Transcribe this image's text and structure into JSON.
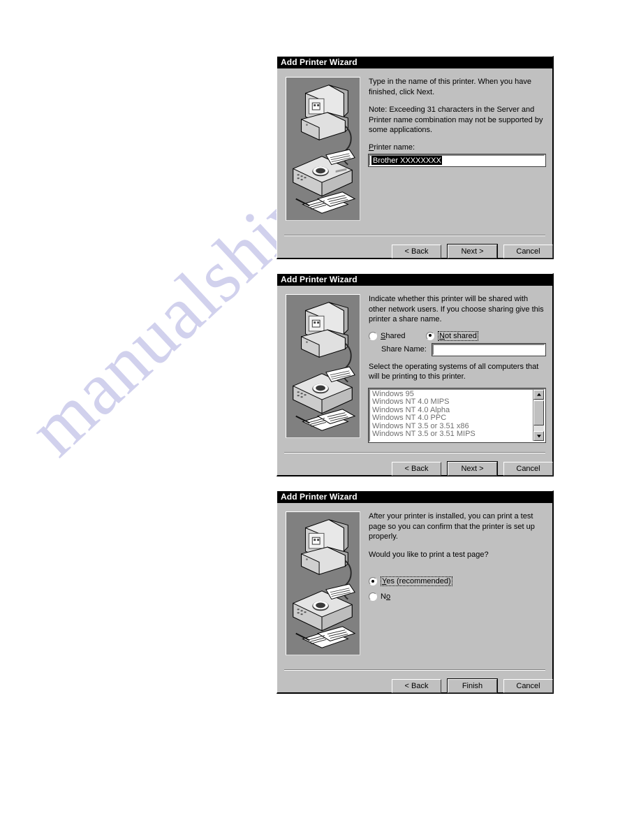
{
  "page": {
    "watermark_text": "manualshive.com",
    "watermark_color": "#c9c9ea",
    "background_color": "#ffffff"
  },
  "common": {
    "title": "Add Printer Wizard",
    "back_label": "< Back",
    "next_label": "Next >",
    "cancel_label": "Cancel",
    "finish_label": "Finish"
  },
  "dialog1": {
    "title": "Add Printer Wizard",
    "body_line1": "Type in the name of this printer.  When you have finished, click Next.",
    "body_line2": "Note:  Exceeding 31 characters in the Server and Printer name combination may not be supported by some applications.",
    "printer_name_label": "Printer name:",
    "printer_name_value": "Brother XXXXXXXX",
    "buttons": {
      "back": "< Back",
      "next": "Next >",
      "cancel": "Cancel"
    }
  },
  "dialog2": {
    "title": "Add Printer Wizard",
    "body_line1": "Indicate whether this printer will be shared with other network users. If you choose sharing give this printer a share name.",
    "radio_shared": "Shared",
    "radio_not_shared": "Not shared",
    "selected_sharing_option": "Not shared",
    "share_name_label": "Share Name:",
    "share_name_value": "",
    "os_prompt": "Select the operating systems of all computers that will be printing to this printer.",
    "os_list": [
      "Windows 95",
      "Windows NT 4.0 MIPS",
      "Windows NT 4.0 Alpha",
      "Windows NT 4.0 PPC",
      "Windows NT 3.5 or 3.51 x86",
      "Windows NT 3.5 or 3.51 MIPS"
    ],
    "buttons": {
      "back": "< Back",
      "next": "Next >",
      "cancel": "Cancel"
    }
  },
  "dialog3": {
    "title": "Add Printer Wizard",
    "body_line1": "After your printer is installed, you can print a test page so you can confirm that the printer is set up properly.",
    "body_line2": "Would you like to print a test page?",
    "radio_yes": "Yes (recommended)",
    "radio_no": "No",
    "selected_test_page_option": "Yes (recommended)",
    "buttons": {
      "back": "< Back",
      "finish": "Finish",
      "cancel": "Cancel"
    }
  }
}
